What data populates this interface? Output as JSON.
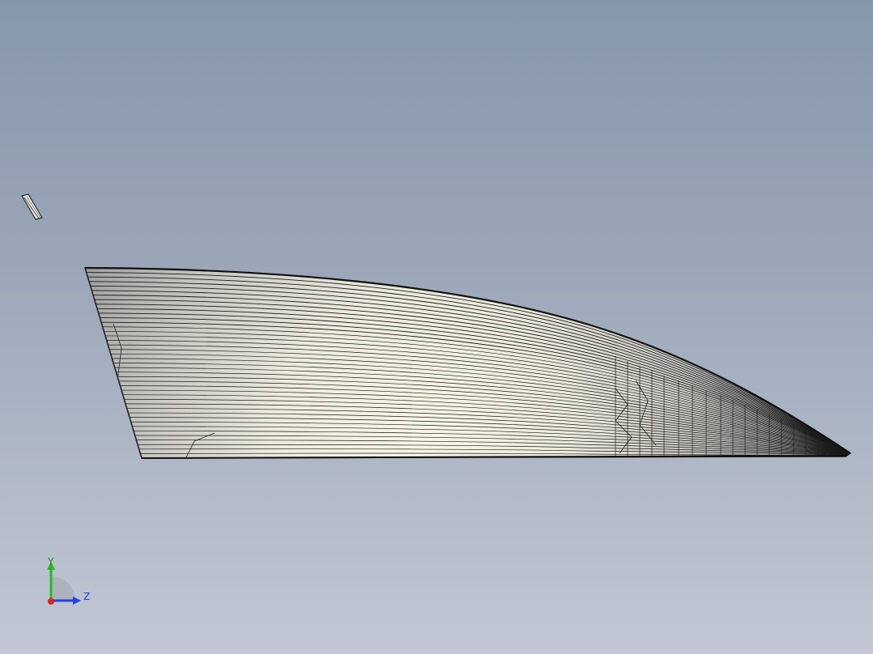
{
  "scene": {
    "background_top": "#8797ab",
    "background_bottom": "#c2c7d3",
    "model": "wing-fin-wireframe"
  },
  "triad": {
    "y_label": "Y",
    "z_label": "Z",
    "colors": {
      "y": "#22bb22",
      "z": "#2244dd",
      "x": "#dd2222"
    }
  }
}
